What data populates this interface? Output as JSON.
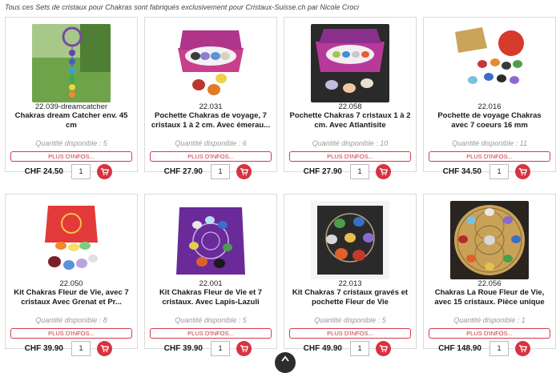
{
  "intro_text": "Tous ces Sets de cristaux pour Chakras sont fabriqués exclusivement pour Cristaux-Suisse.ch par Nicole Croci",
  "info_label": "PLUS D'INFOS...",
  "stock_prefix": "Quantité disponible : ",
  "products": [
    {
      "ref": "22.039-dreamcatcher",
      "title": "Chakras dream Catcher env. 45 cm",
      "stock": "Quantité disponible : 5",
      "price": "CHF 24.50",
      "qty": "1"
    },
    {
      "ref": "22.031",
      "title": "Pochette Chakras de voyage, 7 cristaux 1 à 2 cm. Avec émerau...",
      "stock": "Quantité disponible : 6",
      "price": "CHF 27.90",
      "qty": "1"
    },
    {
      "ref": "22.058",
      "title": "Pochette Chakras 7 cristaux 1 à 2 cm. Avec Atlantisite",
      "stock": "Quantité disponible : 10",
      "price": "CHF 27.90",
      "qty": "1"
    },
    {
      "ref": "22.016",
      "title": "Pochette de voyage Chakras avec 7 coeurs 16 mm",
      "stock": "Quantité disponible : 11",
      "price": "CHF 34.50",
      "qty": "1"
    },
    {
      "ref": "22.050",
      "title": "Kit Chakras Fleur de Vie, avec 7 cristaux Avec Grenat et Pr...",
      "stock": "Quantité disponible : 8",
      "price": "CHF 39.90",
      "qty": "1"
    },
    {
      "ref": "22.001",
      "title": "Kit Chakras Fleur de Vie et 7 cristaux. Avec Lapis-Lazuli",
      "stock": "Quantité disponible : 5",
      "price": "CHF 39.90",
      "qty": "1"
    },
    {
      "ref": "22.013",
      "title": "Kit Chakras 7 cristaux gravés et pochette Fleur de Vie",
      "stock": "Quantité disponible : 5",
      "price": "CHF 49.90",
      "qty": "1"
    },
    {
      "ref": "22.056",
      "title": "Chakras La Roue Fleur de Vie, avec 15 cristaux. Pièce unique",
      "stock": "Quantité disponible : 1",
      "price": "CHF 148.90",
      "qty": "1"
    }
  ],
  "icons": {
    "cart": "shopping-cart-icon",
    "scroll": "chevron-up-icon"
  },
  "colors": {
    "accent": "#d8323f",
    "info_border": "#d43a4c",
    "muted": "#9a9a9a"
  }
}
